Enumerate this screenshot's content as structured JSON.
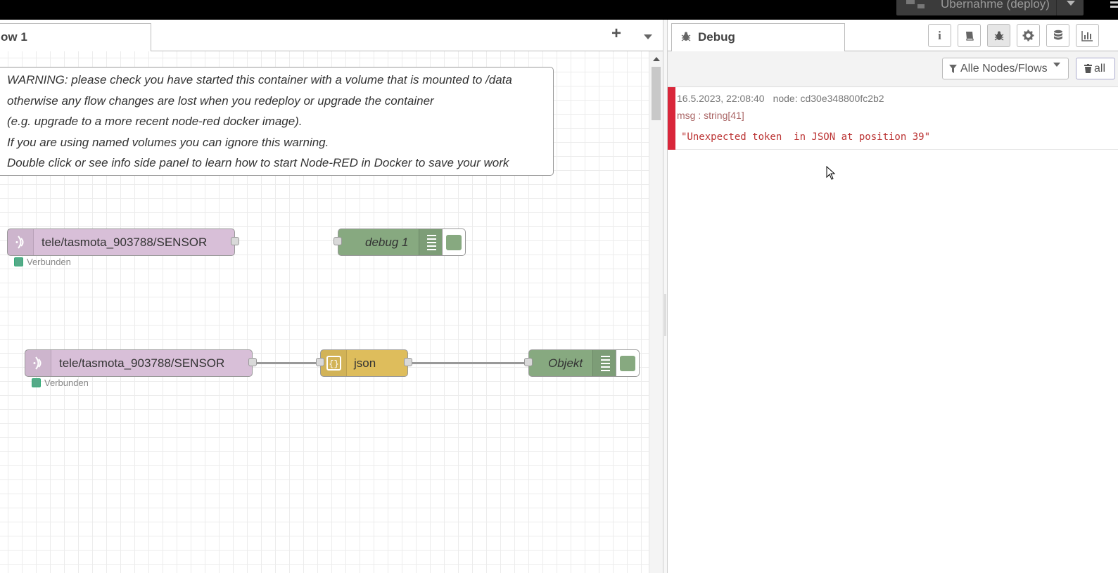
{
  "header": {
    "deploy_label": "Übernahme (deploy)",
    "deploy_icon": "deploy-icon",
    "menu_icon": "hamburger-menu-icon"
  },
  "workspace": {
    "tab_label": "ow 1",
    "add_icon": "+",
    "more_icon": "caret-down-icon"
  },
  "comment": {
    "lines": [
      "WARNING: please check you have started this container with a volume that is mounted to /data",
      "otherwise any flow changes are lost when you redeploy or upgrade the container",
      "(e.g. upgrade to a more recent node-red docker image).",
      "If you are using named volumes you can ignore this warning.",
      "Double click or see info side panel to learn how to start Node-RED in Docker to save your work"
    ]
  },
  "nodes": {
    "mqtt1": {
      "label": "tele/tasmota_903788/SENSOR",
      "status": "Verbunden",
      "color": "#d8bfd8"
    },
    "debug1": {
      "label": "debug 1",
      "color": "#87a980"
    },
    "mqtt2": {
      "label": "tele/tasmota_903788/SENSOR",
      "status": "Verbunden",
      "color": "#d8bfd8"
    },
    "json": {
      "label": "json",
      "color": "#debd5c"
    },
    "objekt": {
      "label": "Objekt",
      "color": "#87a980"
    }
  },
  "sidebar": {
    "tab_label": "Debug",
    "tab_icon": "bug-icon",
    "buttons": [
      "info-icon",
      "book-icon",
      "bug-icon",
      "gear-icon",
      "database-icon",
      "chart-icon"
    ],
    "filter_label": "Alle Nodes/Flows",
    "clear_label": "all",
    "message": {
      "timestamp": "16.5.2023, 22:08:40",
      "node": "node: cd30e348800fc2b2",
      "type": "msg : string[41]",
      "value": "\"Unexpected token  in JSON at position 39\""
    }
  }
}
